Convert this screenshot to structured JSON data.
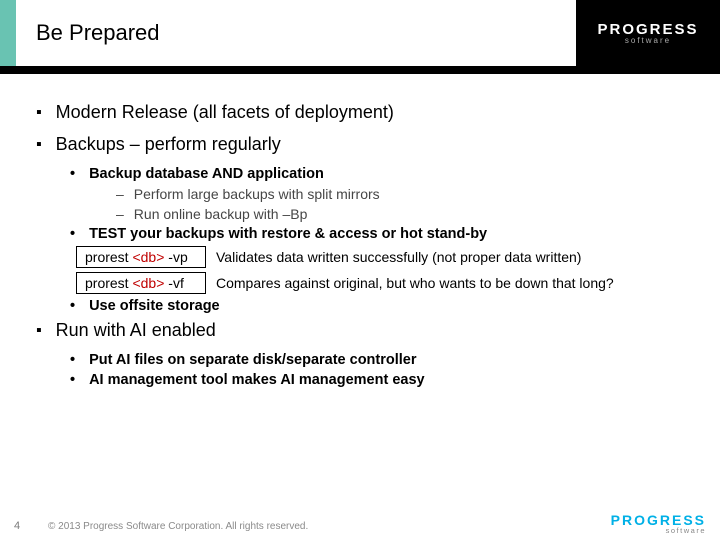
{
  "title": "Be Prepared",
  "brand": {
    "name": "PROGRESS",
    "sub": "software"
  },
  "bullets": {
    "b1": "Modern Release (all facets of deployment)",
    "b2": "Backups – perform regularly",
    "b2_1": "Backup database AND application",
    "b2_1a": "Perform large backups with split mirrors",
    "b2_1b": "Run online backup with –Bp",
    "b2_2": "TEST your backups with restore & access or hot stand-by",
    "cmd1_a": "prorest ",
    "cmd1_b": "<db>",
    "cmd1_c": "  -vp",
    "cmd1_desc": "Validates data written successfully (not proper data written)",
    "cmd2_a": "prorest ",
    "cmd2_b": "<db>",
    "cmd2_c": "  -vf",
    "cmd2_desc": "Compares against original, but who wants to be down that long?",
    "b2_3": "Use offsite storage",
    "b3": "Run with AI enabled",
    "b3_1": "Put AI files on separate disk/separate controller",
    "b3_2": "AI management tool makes AI management easy"
  },
  "footer": {
    "page": "4",
    "copyright": "© 2013 Progress Software Corporation. All rights reserved."
  }
}
